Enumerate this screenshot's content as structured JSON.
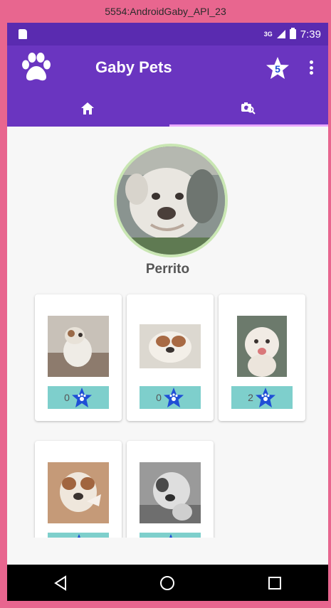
{
  "window": {
    "title": "5554:AndroidGaby_API_23"
  },
  "statusbar": {
    "network": "3G",
    "time": "7:39"
  },
  "appbar": {
    "title": "Gaby Pets",
    "favorites_count": "5"
  },
  "tabs": [
    {
      "id": "home",
      "icon": "home-icon",
      "selected": false
    },
    {
      "id": "search",
      "icon": "photo-search-icon",
      "selected": true
    }
  ],
  "profile": {
    "name": "Perrito"
  },
  "photos": [
    {
      "likes": "0"
    },
    {
      "likes": "0"
    },
    {
      "likes": "2"
    },
    {
      "likes": ""
    },
    {
      "likes": ""
    }
  ],
  "navbar": {
    "buttons": [
      "back-icon",
      "home-circle-icon",
      "recents-icon"
    ]
  },
  "colors": {
    "emulator_frame": "#e8668f",
    "statusbar": "#5a2bb0",
    "primary": "#6a35c0",
    "tab_indicator": "#e9a7ff",
    "like_bar": "#7ecfcc",
    "star": "#1f4fd6",
    "profile_ring": "#c9e6b3"
  }
}
